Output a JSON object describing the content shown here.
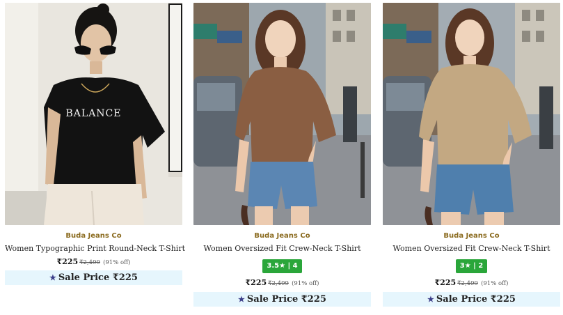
{
  "products": [
    {
      "brand": "Buda Jeans Co",
      "title": "Women Typographic Print Round-Neck T-Shirt",
      "shirt_text": "BALANCE",
      "price": "₹225",
      "mrp": "₹2,499",
      "discount": "(91% off)",
      "sale_label": "Sale Price ₹225",
      "star_icon": "star-icon"
    },
    {
      "brand": "Buda Jeans Co",
      "title": "Women Oversized Fit Crew-Neck T-Shirt",
      "rating": "3.5★ | 4",
      "price": "₹225",
      "mrp": "₹2,499",
      "discount": "(91% off)",
      "sale_label": "Sale Price ₹225",
      "star_icon": "star-icon",
      "tee_color": "#8a5e42"
    },
    {
      "brand": "Buda Jeans Co",
      "title": "Women Oversized Fit Crew-Neck T-Shirt",
      "rating": "3★ | 2",
      "price": "₹225",
      "mrp": "₹2,499",
      "discount": "(91% off)",
      "sale_label": "Sale Price ₹225",
      "star_icon": "star-icon",
      "tee_color": "#c3a882"
    }
  ],
  "colors": {
    "brand": "#8a6a1e",
    "rating_badge": "#2aa63a",
    "sale_bg": "#e6f6fd"
  }
}
